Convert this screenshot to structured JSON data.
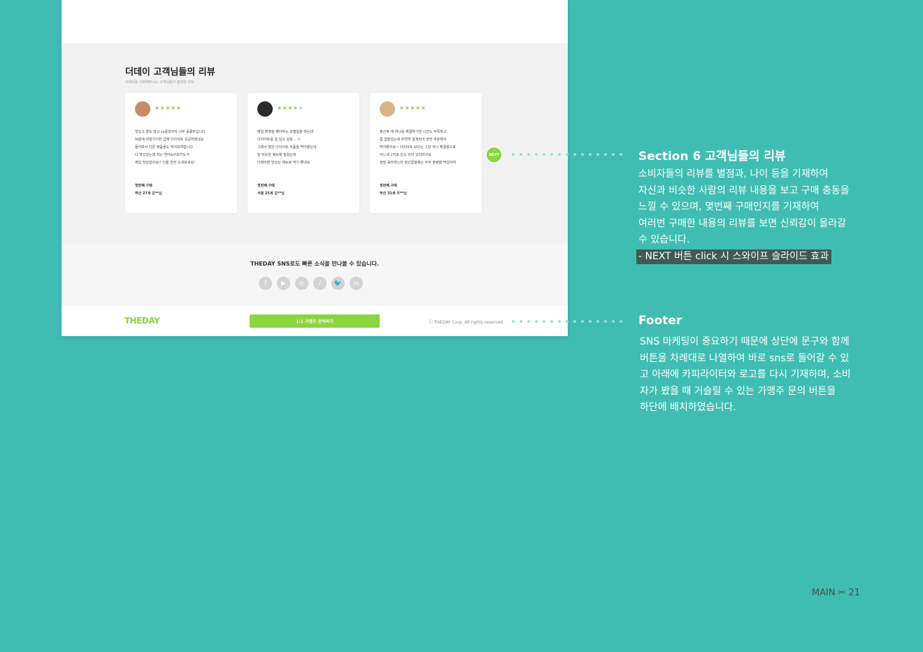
{
  "site": {
    "reviews_title": "더데이 고객님들의 리뷰",
    "reviews_subtitle": "더데이를 사랑해주시는 고객님들의 솔직한 리뷰",
    "next_label": "NEXT",
    "cards": [
      {
        "stars_on": "★★★★★",
        "stars_off": "",
        "lines": [
          "맛있고 양도 많고 cs응대까지 너무 훌륭하십니다",
          "덕분에 여행가기전 급해 다이어트 성공하였네요",
          "들어와서 다른 제품들도 먹어보려합니다",
          "다 맛있었는데 저는 연어&아보카도가",
          "제일 맛있었어요!! 다들 한번 드셔보세요!"
        ],
        "meta1": "첫번째 구매",
        "meta2": "부산 27세 김**님",
        "avatar_color": "#c58b6b"
      },
      {
        "stars_on": "★★★★",
        "stars_off": "★",
        "lines": [
          "매일 촬영을 해야하는 모델일을 하는데",
          "다이어트를 늘 달고 살죠 .. ㅠ",
          "그래서 많은 다이어트 식품을 먹어봤는데",
          "늘 비슷한 메뉴에 질렸는데",
          "더데이면 맛있는 메뉴로 먹기 좋네요"
        ],
        "meta1": "첫번째 구매",
        "meta2": "서울 25세 김**님",
        "avatar_color": "#2a2a2a"
      },
      {
        "stars_on": "★★★★★",
        "stars_off": "",
        "lines": [
          "출산후 애 하나를 해결하기엔 시간도 부족하고",
          "좀 힘들었는데 우연히 알게되어 한번 주문해서",
          "먹어봤어요~ 다이어트 보다는 그냥 끼니 해결용으로",
          "어느새 2키로 감소 되어 있더라구요",
          "정말 육아하느라 정신없을때는 두끼 분량을 먹었어여"
        ],
        "meta1": "첫번째 구매",
        "meta2": "부산 31세 이**님",
        "avatar_color": "#d9b48a"
      }
    ],
    "sns_text": "THEDAY SNS로도 빠른 소식을 만나볼 수 있습니다.",
    "sns_icons": [
      "f",
      "▶",
      "◎",
      "♪",
      "🐦",
      "in"
    ],
    "footer_logo": "THEDAY",
    "footer_button": "1:1 가맹주 문의하기",
    "footer_copyright": "ⓒ THEDAY Corp. All rights reserved."
  },
  "annotations": {
    "section6": {
      "title": "Section 6 고객님들의 리뷰",
      "lines": [
        "소비자들의 리뷰를 별점과, 나이 등을 기재하여",
        "자신과 비슷한 사람의 리뷰 내용을 보고 구매 충동을",
        "느낄 수 있으며, 몇번째 구매인지를 기재하여",
        "여러번 구매한 내용의 리뷰를 보면 신뢰감이 올라갈",
        "수 있습니다."
      ],
      "highlight": "- NEXT 버튼 click 시 스와이프 슬라이드 효과"
    },
    "footer": {
      "title": "Footer",
      "lines": [
        "SNS 마케팅이 중요하기 때문에 상단에 문구와 함께",
        "버튼을 차례대로 나열하여 바로 sns로 들어갈 수 있",
        "고 아래에 카피라이터와 로고를 다시 기재하며, 소비",
        "자가 봤을 때 거슬릴 수 있는 가맹주 문의 버튼을",
        "하단에 배치하였습니다."
      ]
    }
  },
  "page": {
    "label": "MAIN",
    "number": "21"
  }
}
